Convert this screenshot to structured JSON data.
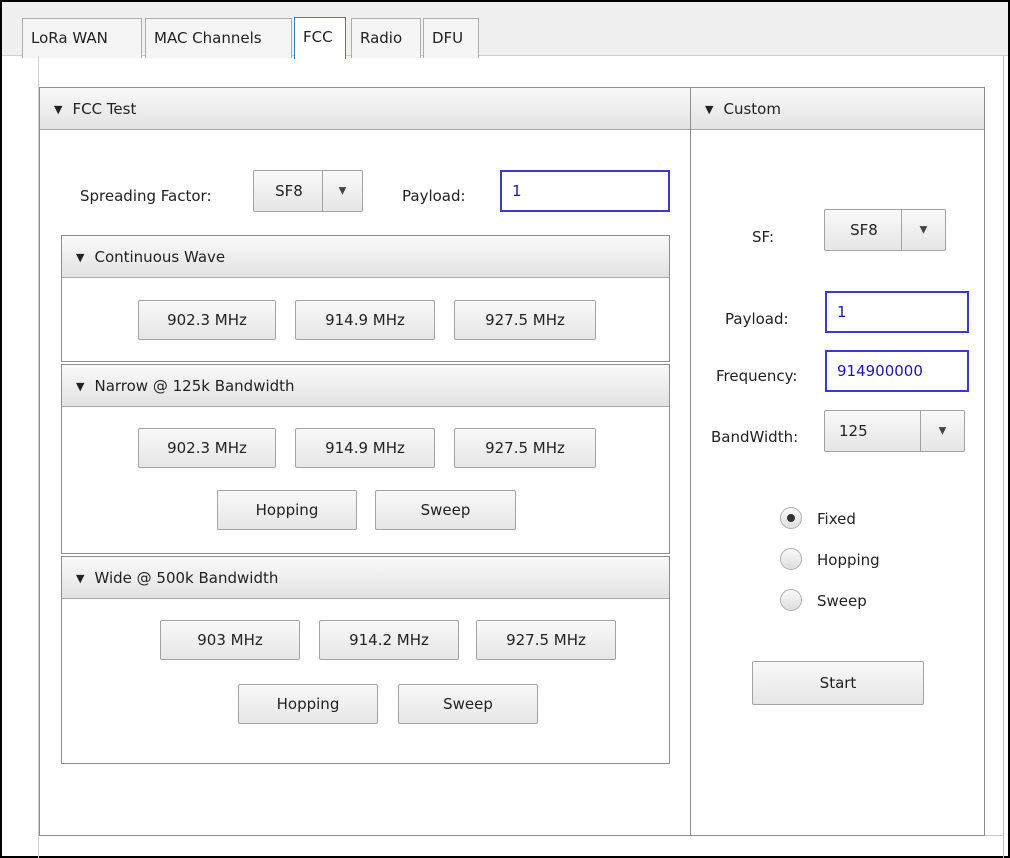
{
  "tabs": [
    {
      "label": "LoRa WAN"
    },
    {
      "label": "MAC Channels"
    },
    {
      "label": "FCC",
      "active": true
    },
    {
      "label": "Radio"
    },
    {
      "label": "DFU"
    }
  ],
  "fcc_test": {
    "title": "FCC Test",
    "spreading_factor_label": "Spreading Factor:",
    "spreading_factor_value": "SF8",
    "payload_label": "Payload:",
    "payload_value": "1",
    "continuous_wave": {
      "title": "Continuous Wave",
      "buttons": [
        "902.3 MHz",
        "914.9 MHz",
        "927.5 MHz"
      ]
    },
    "narrow": {
      "title": "Narrow @ 125k Bandwidth",
      "buttons": [
        "902.3 MHz",
        "914.9 MHz",
        "927.5 MHz"
      ],
      "hopping": "Hopping",
      "sweep": "Sweep"
    },
    "wide": {
      "title": "Wide @ 500k Bandwidth",
      "buttons": [
        "903 MHz",
        "914.2 MHz",
        "927.5 MHz"
      ],
      "hopping": "Hopping",
      "sweep": "Sweep"
    }
  },
  "custom": {
    "title": "Custom",
    "sf_label": "SF:",
    "sf_value": "SF8",
    "payload_label": "Payload:",
    "payload_value": "1",
    "frequency_label": "Frequency:",
    "frequency_value": "914900000",
    "bandwidth_label": "BandWidth:",
    "bandwidth_value": "125",
    "mode_options": [
      {
        "label": "Fixed",
        "selected": true
      },
      {
        "label": "Hopping",
        "selected": false
      },
      {
        "label": "Sweep",
        "selected": false
      }
    ],
    "start_label": "Start"
  },
  "icons": {
    "collapse": "triangle-down-icon",
    "dropdown": "chevron-down-icon"
  }
}
